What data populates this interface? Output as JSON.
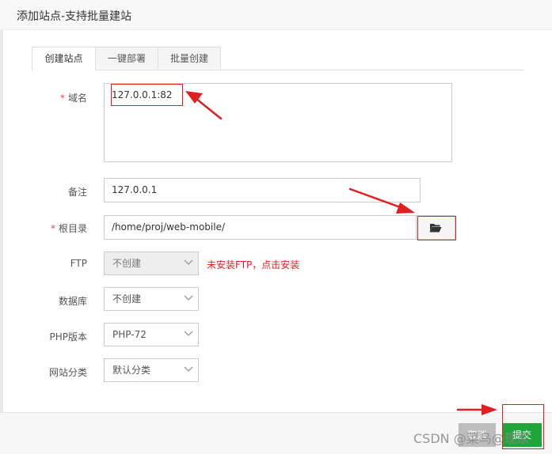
{
  "dialog": {
    "title": "添加站点-支持批量建站"
  },
  "tabs": [
    {
      "label": "创建站点",
      "active": true
    },
    {
      "label": "一键部署",
      "active": false
    },
    {
      "label": "批量创建",
      "active": false
    }
  ],
  "form": {
    "required_mark": "*",
    "domain": {
      "label": "域名",
      "value": "127.0.0.1:82"
    },
    "remark": {
      "label": "备注",
      "value": "127.0.0.1"
    },
    "root_dir": {
      "label": "根目录",
      "value": "/home/proj/web-mobile/"
    },
    "ftp": {
      "label": "FTP",
      "selected": "不创建",
      "note": "未安装FTP，点击安装"
    },
    "database": {
      "label": "数据库",
      "selected": "不创建"
    },
    "php_version": {
      "label": "PHP版本",
      "selected": "PHP-72"
    },
    "site_category": {
      "label": "网站分类",
      "selected": "默认分类"
    }
  },
  "footer": {
    "cancel_label": "取消",
    "submit_label": "提交"
  },
  "watermark": "CSDN @菜鸟@现家",
  "colors": {
    "accent_green": "#20a53a",
    "annotation_red": "#e02020",
    "required_red": "#e54d42"
  },
  "icons": {
    "folder_button": "folder-open-icon",
    "select_arrow": "chevron-down-icon"
  }
}
